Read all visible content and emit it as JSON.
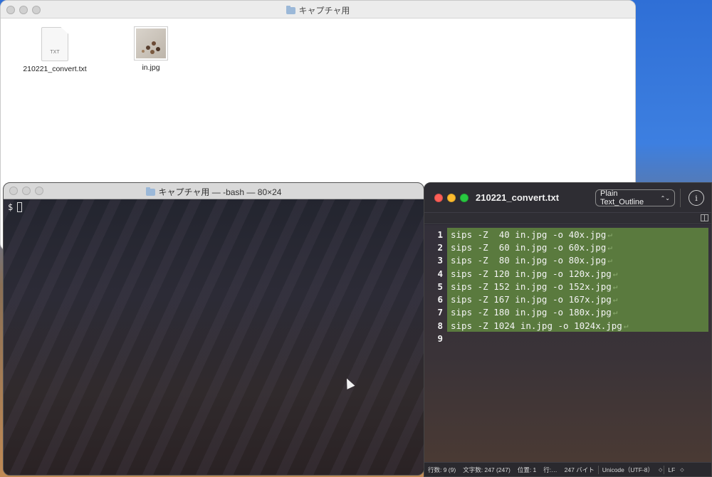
{
  "finder": {
    "title": "キャプチャ用",
    "files": [
      {
        "name": "210221_convert.txt",
        "icon_text": "TXT",
        "icon": "text-document-icon"
      },
      {
        "name": "in.jpg",
        "icon": "image-thumbnail-icon"
      }
    ]
  },
  "terminal": {
    "title": "キャプチャ用 — -bash — 80×24",
    "prompt": "$"
  },
  "editor": {
    "title": "210221_convert.txt",
    "syntax": "Plain Text_Outline",
    "syntax_chevron": "⌃⌄",
    "info_label": "i",
    "eol_glyph": "↵",
    "lines": [
      {
        "num": "1",
        "text": "sips -Z  40 in.jpg -o 40x.jpg",
        "selected": true
      },
      {
        "num": "2",
        "text": "sips -Z  60 in.jpg -o 60x.jpg",
        "selected": true
      },
      {
        "num": "3",
        "text": "sips -Z  80 in.jpg -o 80x.jpg",
        "selected": true
      },
      {
        "num": "4",
        "text": "sips -Z 120 in.jpg -o 120x.jpg",
        "selected": true
      },
      {
        "num": "5",
        "text": "sips -Z 152 in.jpg -o 152x.jpg",
        "selected": true
      },
      {
        "num": "6",
        "text": "sips -Z 167 in.jpg -o 167x.jpg",
        "selected": true
      },
      {
        "num": "7",
        "text": "sips -Z 180 in.jpg -o 180x.jpg",
        "selected": true
      },
      {
        "num": "8",
        "text": "sips -Z 1024 in.jpg -o 1024x.jpg",
        "selected": true
      },
      {
        "num": "9",
        "text": "",
        "selected": false
      }
    ],
    "status": {
      "lines": "行数: 9 (9)",
      "chars": "文字数: 247 (247)",
      "position": "位置: 1",
      "line_pos": "行:…",
      "bytes": "247 バイト",
      "encoding": "Unicode（UTF-8）",
      "line_ending": "LF"
    }
  },
  "colors": {
    "selection": "#5a7a3e",
    "close": "#fe5f57",
    "minimize": "#febc2e",
    "zoom": "#28c840"
  }
}
